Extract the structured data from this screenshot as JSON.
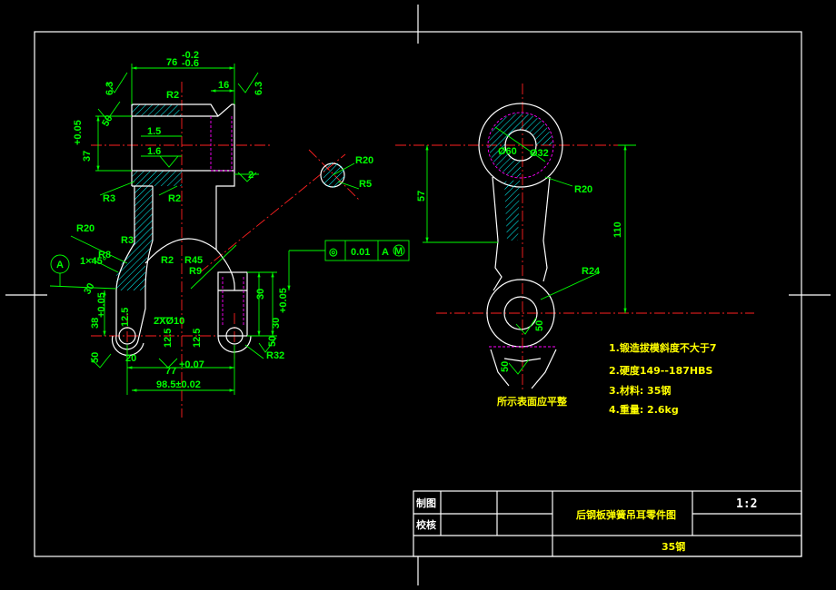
{
  "drawing": {
    "front_view": {
      "dims": {
        "width_76": "76",
        "width_76_tol_upper": "-0.2",
        "width_76_tol_lower": "-0.6",
        "r2_top": "R2",
        "dim_16": "16",
        "rough_63_left": "6.3",
        "rough_63_right": "6.3",
        "dim_50_top": "50",
        "dim_15": "1.5",
        "dim_16b": "1.6",
        "dim_37": "37",
        "dim_37_tol": "+0.05",
        "dim_2": "2",
        "r3_left": "R3",
        "r2_mid": "R2",
        "r20_left": "R20",
        "r3_lower": "R3",
        "r8": "R8",
        "r2_low": "R2",
        "r45": "R45",
        "r9": "R9",
        "chamfer": "1×45°",
        "dim_30_left": "30",
        "dim_38": "38",
        "dim_38_tol": "+0.05",
        "dim_125_a": "12.5",
        "dim_2x10": "2XØ10",
        "dim_125_b": "12.5",
        "dim_125_c": "12.5",
        "dim_50_mid": "50",
        "dim_50_low": "50",
        "dim_30_right": "30",
        "dim_30_right2": "30",
        "dim_30_tol": "+0.05",
        "r32": "R32",
        "dim_77": "77",
        "dim_77_tol": "+0.07",
        "dim_985": "98.5±0.02",
        "dim_20": "20"
      },
      "datum_label": "A"
    },
    "section_view": {
      "r20": "R20",
      "r5": "R5"
    },
    "tolerance_frame": {
      "symbol": "◎",
      "value": "0.01",
      "datum": "A",
      "modifier": "M"
    },
    "side_view": {
      "dims": {
        "d60": "Ø60",
        "d32": "Ø32",
        "r20": "R20",
        "dim_57": "57",
        "dim_110": "110",
        "r24": "R24",
        "dim_50_a": "50",
        "dim_50_b": "50"
      },
      "surface_note": "所示表面应平整"
    },
    "notes": [
      "1.锻造拔模斜度不大于7",
      "2.硬度149--187HBS",
      "3.材料: 35钢",
      "4.重量: 2.6kg"
    ]
  },
  "title_block": {
    "drawn_label": "制图",
    "checked_label": "校核",
    "part_name": "后钢板弹簧吊耳零件图",
    "scale": "1:2",
    "material": "35钢"
  },
  "colors": {
    "background": "#000000",
    "outline": "#ffffff",
    "dimension": "#00ff00",
    "centerline": "#ff2020",
    "hidden": "#ff00ff",
    "hatch": "#00ffff",
    "notes": "#ffff00"
  }
}
